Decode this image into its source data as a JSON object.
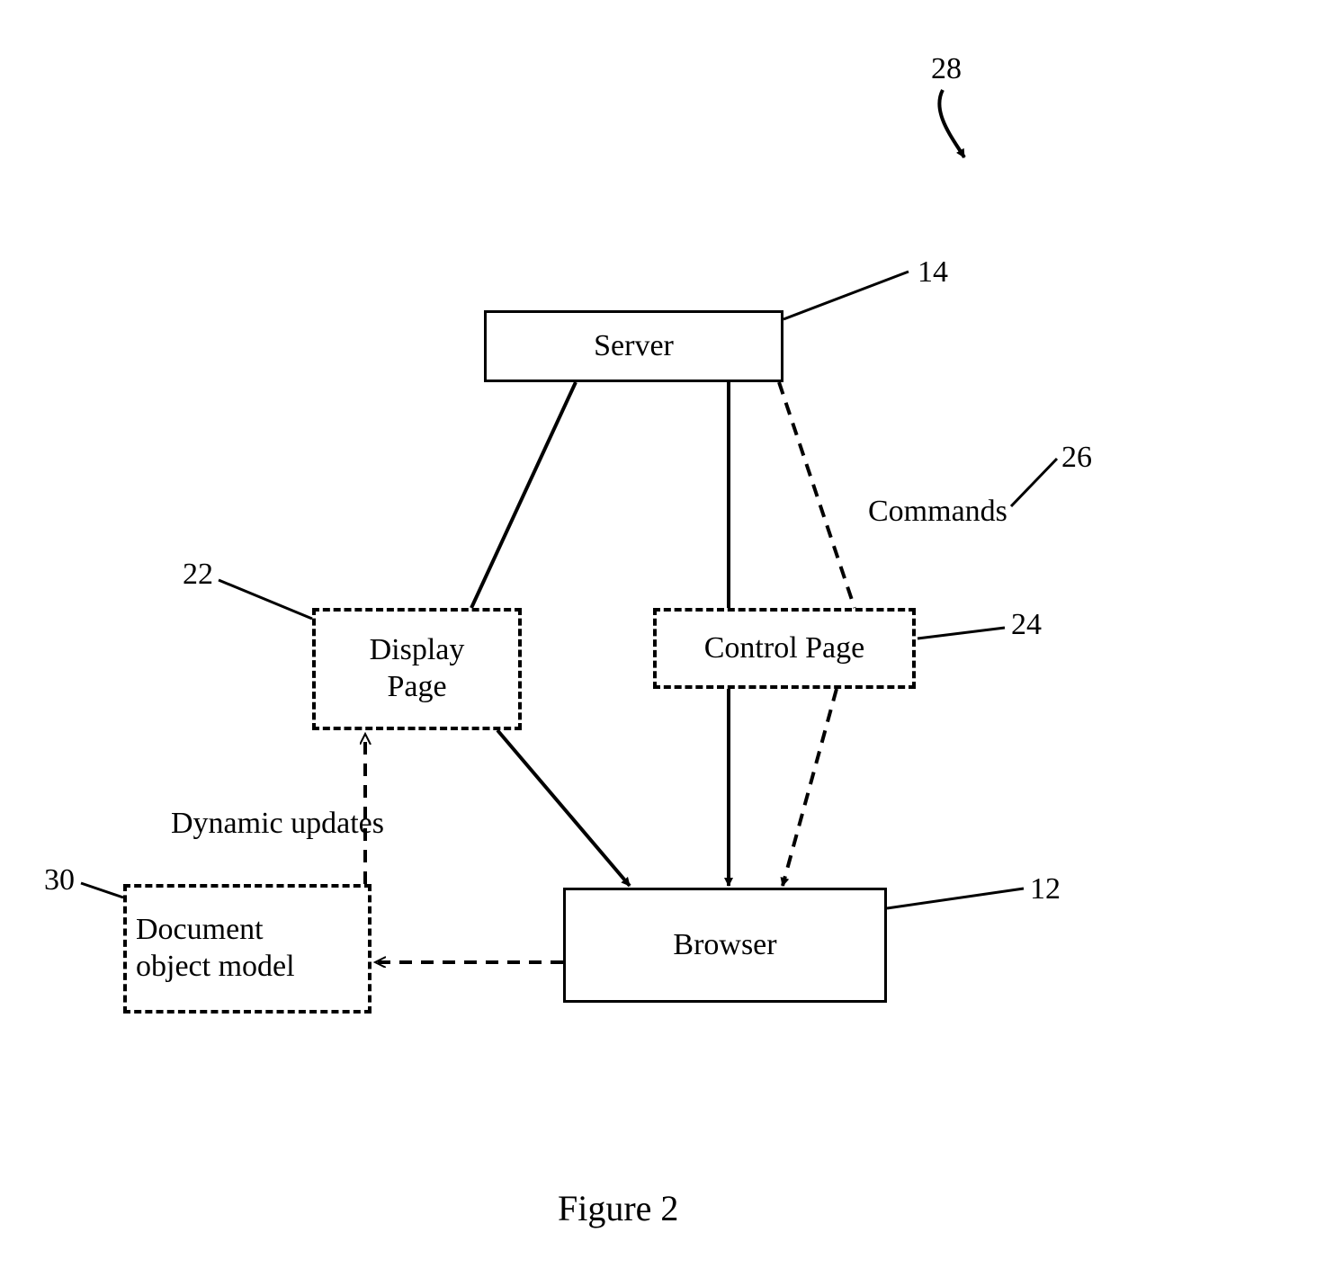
{
  "nodes": {
    "server": {
      "label": "Server",
      "ref": "14"
    },
    "display_page": {
      "label": "Display\nPage",
      "ref": "22"
    },
    "control_page": {
      "label": "Control Page",
      "ref": "24"
    },
    "dom": {
      "label": "Document\nobject model",
      "ref": "30"
    },
    "browser": {
      "label": "Browser",
      "ref": "12"
    }
  },
  "annotations": {
    "figure_ref": "28",
    "commands": {
      "label": "Commands",
      "ref": "26"
    },
    "dynamic_updates": {
      "label": "Dynamic updates"
    }
  },
  "figure_caption": "Figure 2"
}
